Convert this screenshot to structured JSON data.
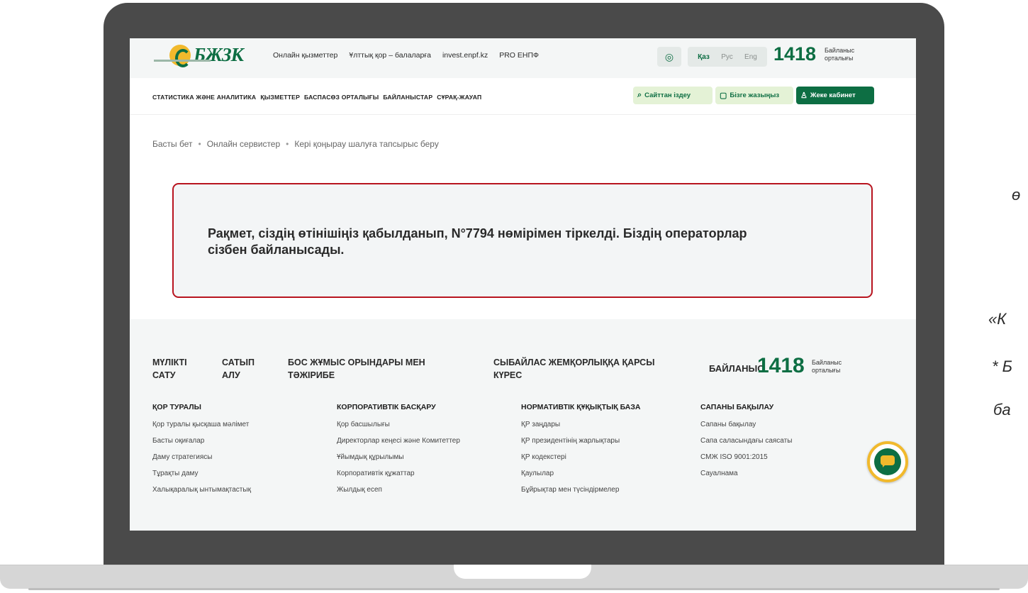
{
  "header": {
    "logo_text": "БЖЗК",
    "top_links": [
      "Онлайн қызметтер",
      "Ұлттық қор – балаларға",
      "invest.enpf.kz",
      "PRO ЕНПФ"
    ],
    "languages": [
      "Қаз",
      "Рус",
      "Eng"
    ],
    "active_language": "Қаз",
    "phone": "1418",
    "phone_label_1": "Байланыс",
    "phone_label_2": "орталығы"
  },
  "nav": {
    "items": [
      "СТАТИСТИКА ЖӘНЕ АНАЛИТИКА",
      "ҚЫЗМЕТТЕР",
      "БАСПАСӨЗ ОРТАЛЫҒЫ",
      "БАЙЛАНЫСТАР",
      "СҰРАҚ-ЖАУАП"
    ],
    "search_label": "Сайттан іздеу",
    "write_label": "Бізге жазыңыз",
    "cabinet_label": "Жеке кабинет"
  },
  "breadcrumb": {
    "items": [
      "Басты бет",
      "Онлайн сервистер",
      "Кері қоңырау шалуға тапсырыс беру"
    ],
    "separator": "•"
  },
  "message": {
    "text": "Рақмет, сіздің өтінішіңіз қабылданып, N°7794 нөмірімен тіркелді. Біздің операторлар сізбен байланысады."
  },
  "footer": {
    "top_links": [
      {
        "line1": "МҮЛІКТІ",
        "line2": "САТУ"
      },
      {
        "line1": "САТЫП",
        "line2": "АЛУ"
      },
      {
        "line1": "БОС ЖҰМЫС ОРЫНДАРЫ МЕН",
        "line2": "ТӘЖІРИБЕ"
      },
      {
        "line1": "СЫБАЙЛАС ЖЕМҚОРЛЫҚҚА ҚАРСЫ",
        "line2": "КҮРЕС"
      }
    ],
    "contact_label": "БАЙЛАНЫС",
    "phone": "1418",
    "phone_label_1": "Байланыс",
    "phone_label_2": "орталығы",
    "columns": [
      {
        "title": "ҚОР ТУРАЛЫ",
        "links": [
          "Қор туралы қысқаша мәлімет",
          "Басты оқиғалар",
          "Даму стратегиясы",
          "Тұрақты даму",
          "Халықаралық ынтымақтастық"
        ]
      },
      {
        "title": "КОРПОРАТИВТІК БАСҚАРУ",
        "links": [
          "Қор басшылығы",
          "Директорлар кеңесі және Комитеттер",
          "Ұйымдық құрылымы",
          "Корпоративтік құжаттар",
          "Жылдық есеп"
        ]
      },
      {
        "title": "НОРМАТИВТІК ҚҰҚЫҚТЫҚ БАЗА",
        "links": [
          "ҚР заңдары",
          "ҚР президентінің жарлықтары",
          "ҚР кодекстері",
          "Қаулылар",
          "Бұйрықтар мен түсіндірмелер"
        ]
      },
      {
        "title": "САПАНЫ БАҚЫЛАУ",
        "links": [
          "Сапаны бақылау",
          "Сапа саласындағы саясаты",
          "СМЖ ISO 9001:2015",
          "Сауалнама"
        ]
      }
    ]
  },
  "side_fragments": [
    "ө",
    "«К",
    "* Б",
    "ба"
  ],
  "colors": {
    "brand_green": "#0d6e43",
    "brand_yellow": "#f1b92c",
    "alert_border": "#b8141f",
    "laptop_frame": "#4a4a4a"
  }
}
